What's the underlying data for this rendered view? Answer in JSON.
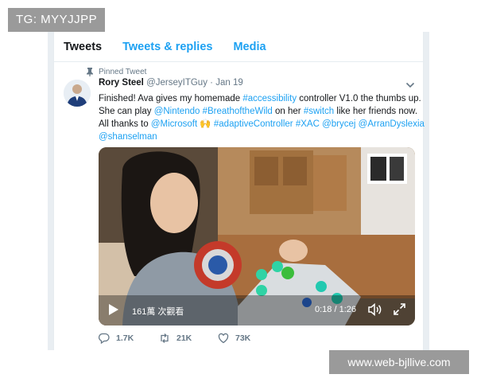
{
  "watermarks": {
    "top": "TG: MYYJJPP",
    "bottom": "www.web-bjllive.com"
  },
  "tabs": [
    {
      "label": "Tweets",
      "active": true
    },
    {
      "label": "Tweets & replies",
      "active": false
    },
    {
      "label": "Media",
      "active": false
    }
  ],
  "tweet": {
    "pinned_label": "Pinned Tweet",
    "author_name": "Rory Steel",
    "handle": "@JerseyITGuy",
    "separator": "·",
    "date": "Jan 19",
    "text": {
      "l1_a": "Finished! Ava gives my homemade ",
      "l1_link": "#accessibility",
      "l1_b": " controller V1.0 the thumbs up.",
      "l2_a": "She can play ",
      "l2_link1": "@Nintendo",
      "l2_sp": " ",
      "l2_link2": "#BreathoftheWild",
      "l2_b": " on her ",
      "l2_link3": "#switch",
      "l2_c": " like her friends now.",
      "l3_a": "All thanks to ",
      "l3_link1": "@Microsoft",
      "l3_emoji": " 🙌 ",
      "l3_link2": "#adaptiveController",
      "l3_sp1": " ",
      "l3_link3": "#XAC",
      "l3_sp2": " ",
      "l3_link4": "@brycej",
      "l3_sp3": " ",
      "l3_link5": "@ArranDyslexia",
      "l4_link": "@shanselman"
    },
    "video": {
      "views": "161萬 次觀看",
      "time": "0:18 / 1:26"
    },
    "actions": {
      "replies": "1.7K",
      "retweets": "21K",
      "likes": "73K"
    }
  },
  "colors": {
    "link": "#1da1f2",
    "text": "#14171a",
    "muted": "#657786"
  },
  "icons": [
    "pin-icon",
    "chevron-down-icon",
    "play-icon",
    "volume-icon",
    "fullscreen-icon",
    "reply-icon",
    "retweet-icon",
    "like-icon"
  ]
}
